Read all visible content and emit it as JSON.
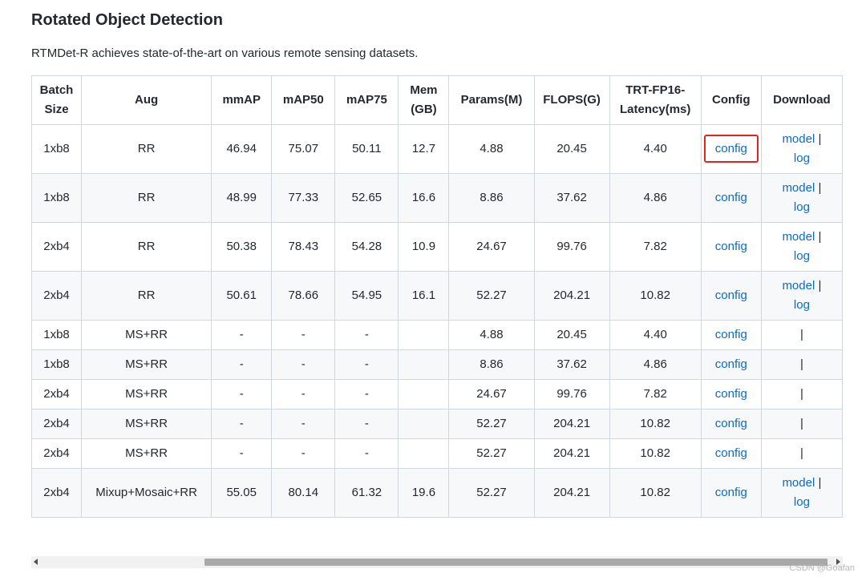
{
  "page": {
    "title": "Rotated Object Detection",
    "description": "RTMDet-R achieves state-of-the-art on various remote sensing datasets."
  },
  "table": {
    "headers": [
      [
        "Batch",
        "Size"
      ],
      [
        "Aug"
      ],
      [
        "mmAP"
      ],
      [
        "mAP50"
      ],
      [
        "mAP75"
      ],
      [
        "Mem",
        "(GB)"
      ],
      [
        "Params(M)"
      ],
      [
        "FLOPS(G)"
      ],
      [
        "TRT-FP16-",
        "Latency(ms)"
      ],
      [
        "Config"
      ],
      [
        "Download"
      ]
    ],
    "rows": [
      {
        "batch": "1xb8",
        "aug": "RR",
        "mmap": "46.94",
        "map50": "75.07",
        "map75": "50.11",
        "mem": "12.7",
        "params": "4.88",
        "flops": "20.45",
        "latency": "4.40",
        "config": "config",
        "model": "model",
        "sep": "|",
        "log": "log"
      },
      {
        "batch": "1xb8",
        "aug": "RR",
        "mmap": "48.99",
        "map50": "77.33",
        "map75": "52.65",
        "mem": "16.6",
        "params": "8.86",
        "flops": "37.62",
        "latency": "4.86",
        "config": "config",
        "model": "model",
        "sep": "|",
        "log": "log"
      },
      {
        "batch": "2xb4",
        "aug": "RR",
        "mmap": "50.38",
        "map50": "78.43",
        "map75": "54.28",
        "mem": "10.9",
        "params": "24.67",
        "flops": "99.76",
        "latency": "7.82",
        "config": "config",
        "model": "model",
        "sep": "|",
        "log": "log"
      },
      {
        "batch": "2xb4",
        "aug": "RR",
        "mmap": "50.61",
        "map50": "78.66",
        "map75": "54.95",
        "mem": "16.1",
        "params": "52.27",
        "flops": "204.21",
        "latency": "10.82",
        "config": "config",
        "model": "model",
        "sep": "|",
        "log": "log"
      },
      {
        "batch": "1xb8",
        "aug": "MS+RR",
        "mmap": "-",
        "map50": "-",
        "map75": "-",
        "mem": "",
        "params": "4.88",
        "flops": "20.45",
        "latency": "4.40",
        "config": "config",
        "model": "",
        "sep": "|",
        "log": ""
      },
      {
        "batch": "1xb8",
        "aug": "MS+RR",
        "mmap": "-",
        "map50": "-",
        "map75": "-",
        "mem": "",
        "params": "8.86",
        "flops": "37.62",
        "latency": "4.86",
        "config": "config",
        "model": "",
        "sep": "|",
        "log": ""
      },
      {
        "batch": "2xb4",
        "aug": "MS+RR",
        "mmap": "-",
        "map50": "-",
        "map75": "-",
        "mem": "",
        "params": "24.67",
        "flops": "99.76",
        "latency": "7.82",
        "config": "config",
        "model": "",
        "sep": "|",
        "log": ""
      },
      {
        "batch": "2xb4",
        "aug": "MS+RR",
        "mmap": "-",
        "map50": "-",
        "map75": "-",
        "mem": "",
        "params": "52.27",
        "flops": "204.21",
        "latency": "10.82",
        "config": "config",
        "model": "",
        "sep": "|",
        "log": ""
      },
      {
        "batch": "2xb4",
        "aug": "MS+RR",
        "mmap": "-",
        "map50": "-",
        "map75": "-",
        "mem": "",
        "params": "52.27",
        "flops": "204.21",
        "latency": "10.82",
        "config": "config",
        "model": "",
        "sep": "|",
        "log": ""
      },
      {
        "batch": "2xb4",
        "aug": "Mixup+Mosaic+RR",
        "mmap": "55.05",
        "map50": "80.14",
        "map75": "61.32",
        "mem": "19.6",
        "params": "52.27",
        "flops": "204.21",
        "latency": "10.82",
        "config": "config",
        "model": "model",
        "sep": "|",
        "log": "log"
      }
    ]
  },
  "colors": {
    "link": "#0969da",
    "highlight": "#e1251b",
    "border": "#d0d7de",
    "row_alt": "#f6f8fa"
  },
  "icons": {
    "scroll_left": "triangle-left",
    "scroll_right": "triangle-right"
  },
  "watermark": "CSDN @Goafan"
}
